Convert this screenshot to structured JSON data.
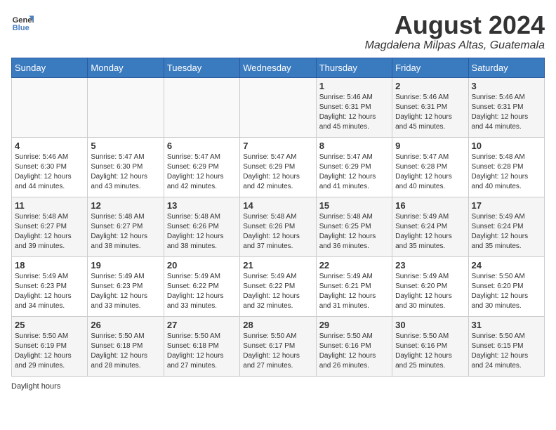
{
  "header": {
    "logo_general": "General",
    "logo_blue": "Blue",
    "month_year": "August 2024",
    "location": "Magdalena Milpas Altas, Guatemala"
  },
  "days_of_week": [
    "Sunday",
    "Monday",
    "Tuesday",
    "Wednesday",
    "Thursday",
    "Friday",
    "Saturday"
  ],
  "weeks": [
    [
      {
        "day": "",
        "info": ""
      },
      {
        "day": "",
        "info": ""
      },
      {
        "day": "",
        "info": ""
      },
      {
        "day": "",
        "info": ""
      },
      {
        "day": "1",
        "info": "Sunrise: 5:46 AM\nSunset: 6:31 PM\nDaylight: 12 hours\nand 45 minutes."
      },
      {
        "day": "2",
        "info": "Sunrise: 5:46 AM\nSunset: 6:31 PM\nDaylight: 12 hours\nand 45 minutes."
      },
      {
        "day": "3",
        "info": "Sunrise: 5:46 AM\nSunset: 6:31 PM\nDaylight: 12 hours\nand 44 minutes."
      }
    ],
    [
      {
        "day": "4",
        "info": "Sunrise: 5:46 AM\nSunset: 6:30 PM\nDaylight: 12 hours\nand 44 minutes."
      },
      {
        "day": "5",
        "info": "Sunrise: 5:47 AM\nSunset: 6:30 PM\nDaylight: 12 hours\nand 43 minutes."
      },
      {
        "day": "6",
        "info": "Sunrise: 5:47 AM\nSunset: 6:29 PM\nDaylight: 12 hours\nand 42 minutes."
      },
      {
        "day": "7",
        "info": "Sunrise: 5:47 AM\nSunset: 6:29 PM\nDaylight: 12 hours\nand 42 minutes."
      },
      {
        "day": "8",
        "info": "Sunrise: 5:47 AM\nSunset: 6:29 PM\nDaylight: 12 hours\nand 41 minutes."
      },
      {
        "day": "9",
        "info": "Sunrise: 5:47 AM\nSunset: 6:28 PM\nDaylight: 12 hours\nand 40 minutes."
      },
      {
        "day": "10",
        "info": "Sunrise: 5:48 AM\nSunset: 6:28 PM\nDaylight: 12 hours\nand 40 minutes."
      }
    ],
    [
      {
        "day": "11",
        "info": "Sunrise: 5:48 AM\nSunset: 6:27 PM\nDaylight: 12 hours\nand 39 minutes."
      },
      {
        "day": "12",
        "info": "Sunrise: 5:48 AM\nSunset: 6:27 PM\nDaylight: 12 hours\nand 38 minutes."
      },
      {
        "day": "13",
        "info": "Sunrise: 5:48 AM\nSunset: 6:26 PM\nDaylight: 12 hours\nand 38 minutes."
      },
      {
        "day": "14",
        "info": "Sunrise: 5:48 AM\nSunset: 6:26 PM\nDaylight: 12 hours\nand 37 minutes."
      },
      {
        "day": "15",
        "info": "Sunrise: 5:48 AM\nSunset: 6:25 PM\nDaylight: 12 hours\nand 36 minutes."
      },
      {
        "day": "16",
        "info": "Sunrise: 5:49 AM\nSunset: 6:24 PM\nDaylight: 12 hours\nand 35 minutes."
      },
      {
        "day": "17",
        "info": "Sunrise: 5:49 AM\nSunset: 6:24 PM\nDaylight: 12 hours\nand 35 minutes."
      }
    ],
    [
      {
        "day": "18",
        "info": "Sunrise: 5:49 AM\nSunset: 6:23 PM\nDaylight: 12 hours\nand 34 minutes."
      },
      {
        "day": "19",
        "info": "Sunrise: 5:49 AM\nSunset: 6:23 PM\nDaylight: 12 hours\nand 33 minutes."
      },
      {
        "day": "20",
        "info": "Sunrise: 5:49 AM\nSunset: 6:22 PM\nDaylight: 12 hours\nand 33 minutes."
      },
      {
        "day": "21",
        "info": "Sunrise: 5:49 AM\nSunset: 6:22 PM\nDaylight: 12 hours\nand 32 minutes."
      },
      {
        "day": "22",
        "info": "Sunrise: 5:49 AM\nSunset: 6:21 PM\nDaylight: 12 hours\nand 31 minutes."
      },
      {
        "day": "23",
        "info": "Sunrise: 5:49 AM\nSunset: 6:20 PM\nDaylight: 12 hours\nand 30 minutes."
      },
      {
        "day": "24",
        "info": "Sunrise: 5:50 AM\nSunset: 6:20 PM\nDaylight: 12 hours\nand 30 minutes."
      }
    ],
    [
      {
        "day": "25",
        "info": "Sunrise: 5:50 AM\nSunset: 6:19 PM\nDaylight: 12 hours\nand 29 minutes."
      },
      {
        "day": "26",
        "info": "Sunrise: 5:50 AM\nSunset: 6:18 PM\nDaylight: 12 hours\nand 28 minutes."
      },
      {
        "day": "27",
        "info": "Sunrise: 5:50 AM\nSunset: 6:18 PM\nDaylight: 12 hours\nand 27 minutes."
      },
      {
        "day": "28",
        "info": "Sunrise: 5:50 AM\nSunset: 6:17 PM\nDaylight: 12 hours\nand 27 minutes."
      },
      {
        "day": "29",
        "info": "Sunrise: 5:50 AM\nSunset: 6:16 PM\nDaylight: 12 hours\nand 26 minutes."
      },
      {
        "day": "30",
        "info": "Sunrise: 5:50 AM\nSunset: 6:16 PM\nDaylight: 12 hours\nand 25 minutes."
      },
      {
        "day": "31",
        "info": "Sunrise: 5:50 AM\nSunset: 6:15 PM\nDaylight: 12 hours\nand 24 minutes."
      }
    ]
  ],
  "footer": {
    "daylight_hours_label": "Daylight hours"
  }
}
